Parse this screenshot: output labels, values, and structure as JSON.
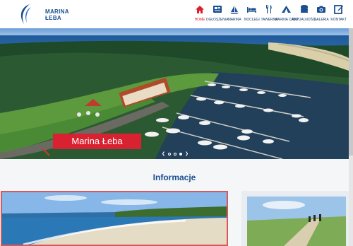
{
  "brand": {
    "line1": "MARINA",
    "line2": "ŁEBA"
  },
  "nav": {
    "items": [
      {
        "label": "HOME",
        "icon": "home-icon",
        "active": true
      },
      {
        "label": "OGŁOSZENIA",
        "icon": "news-icon",
        "active": false
      },
      {
        "label": "MARINA",
        "icon": "marina-icon",
        "active": false
      },
      {
        "label": "NOCLEGI",
        "icon": "bed-icon",
        "active": false
      },
      {
        "label": "TAWERNA",
        "icon": "cutlery-icon",
        "active": false
      },
      {
        "label": "MARINA CAMP",
        "icon": "tent-icon",
        "active": false
      },
      {
        "label": "AKTUALNOŚCI",
        "icon": "coins-icon",
        "active": false
      },
      {
        "label": "GALERIA",
        "icon": "camera-icon",
        "active": false
      },
      {
        "label": "KONTAKT",
        "icon": "edit-icon",
        "active": false
      }
    ]
  },
  "hero": {
    "caption": "Marina Łeba",
    "slides": 4,
    "active_slide": 2
  },
  "section": {
    "title": "Informacje"
  },
  "colors": {
    "primary": "#1b4f8f",
    "accent": "#d9202c"
  }
}
